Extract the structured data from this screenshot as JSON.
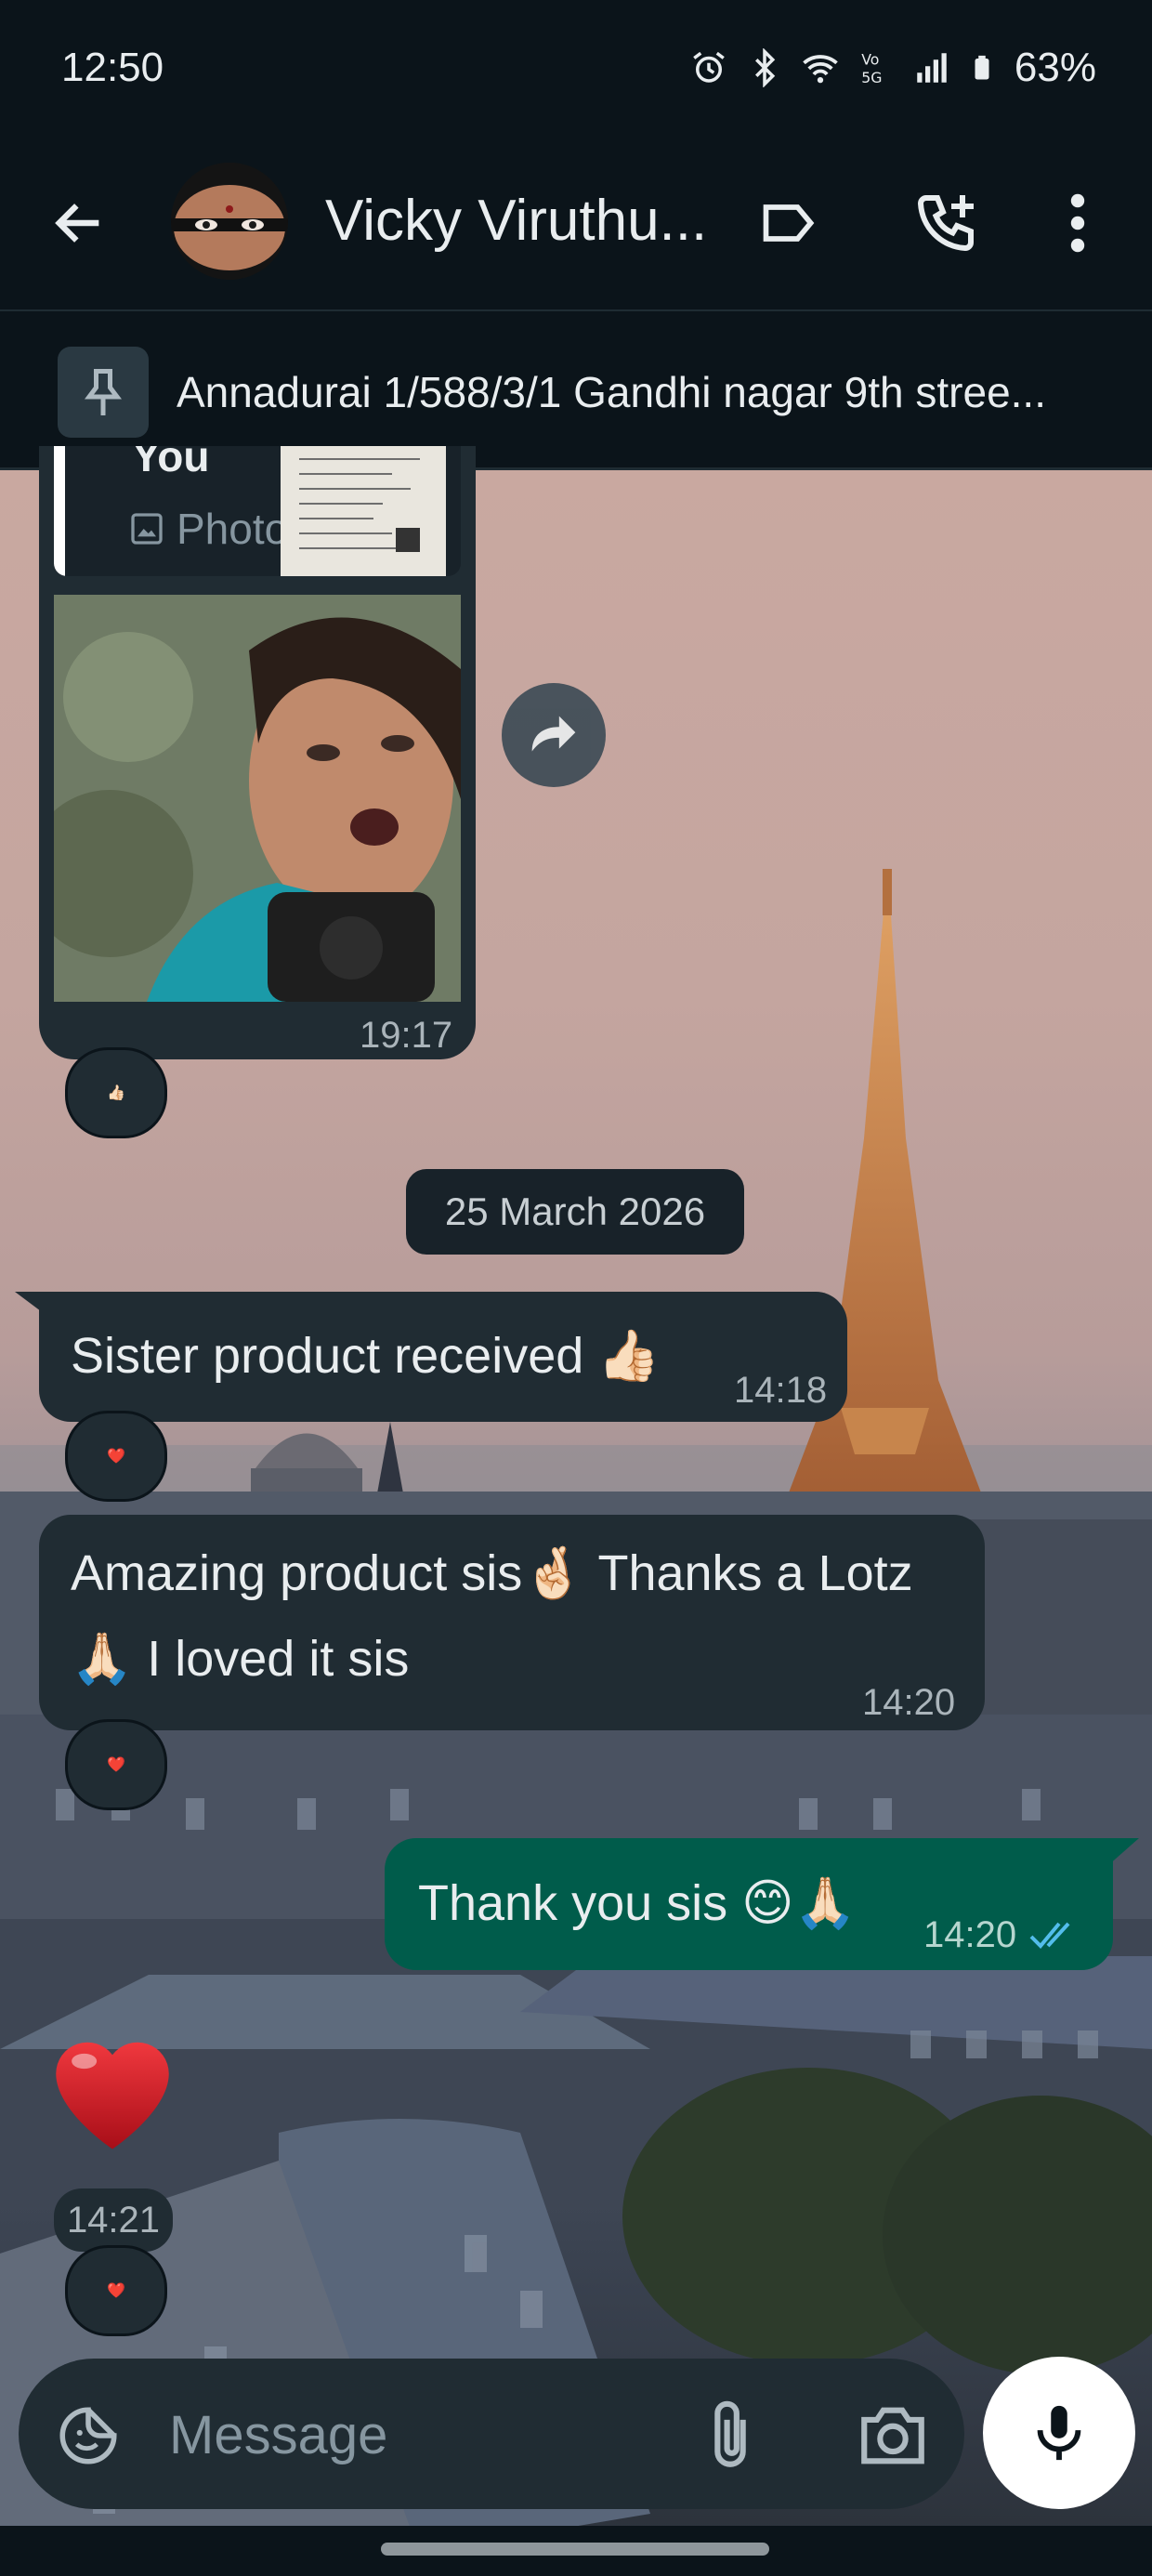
{
  "status_bar": {
    "time": "12:50",
    "battery": "63%",
    "icons": [
      "alarm-icon",
      "bluetooth-icon",
      "wifi-icon",
      "volte-5g-icon",
      "signal-icon",
      "battery-icon"
    ]
  },
  "header": {
    "contact_name": "Vicky Viruthu...",
    "icons": [
      "back-arrow-icon",
      "label-icon",
      "add-call-icon",
      "more-vert-icon"
    ]
  },
  "pinned": {
    "text": "Annadurai 1/588/3/1 Gandhi nagar 9th stree..."
  },
  "messages": {
    "photo_reply": {
      "quote_author": "You",
      "quote_type": "Photo",
      "time": "19:17",
      "reaction": "👍🏻"
    },
    "date_divider": "25 March 2026",
    "msg1": {
      "text": "Sister product received 👍🏻",
      "time": "14:18",
      "reaction": "❤️"
    },
    "msg2": {
      "line1": "Amazing product sis🤞🏻 Thanks a Lotz",
      "line2": "🙏🏻 I loved it sis",
      "time": "14:20",
      "reaction": "❤️"
    },
    "msg3": {
      "text": "Thank you sis 😊🙏🏻",
      "time": "14:20",
      "status": "read"
    },
    "sticker": {
      "emoji": "heart",
      "time": "14:21",
      "reaction": "❤️"
    }
  },
  "composer": {
    "placeholder": "Message"
  },
  "colors": {
    "background": "#0b141a",
    "incoming_bubble": "#202c33",
    "outgoing_bubble": "#005c4b",
    "read_ticks": "#53bdeb"
  }
}
